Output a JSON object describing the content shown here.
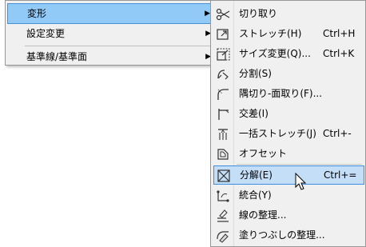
{
  "parent_menu": {
    "items": [
      {
        "label": "変形",
        "has_submenu": true,
        "active": true
      },
      {
        "label": "設定変更",
        "has_submenu": true,
        "active": false
      },
      {
        "label": "基準線/基準面",
        "has_submenu": true,
        "active": false
      }
    ],
    "submenu_arrow": "▶"
  },
  "submenu": {
    "items": [
      {
        "label": "切り取り",
        "shortcut": "",
        "icon": "scissors-icon"
      },
      {
        "label": "ストレッチ(H)",
        "shortcut": "Ctrl+H",
        "icon": "stretch-icon"
      },
      {
        "label": "サイズ変更(Q)...",
        "shortcut": "Ctrl+K",
        "icon": "resize-icon"
      },
      {
        "label": "分割(S)",
        "shortcut": "",
        "icon": "split-icon"
      },
      {
        "label": "隅切り-面取り(F)...",
        "shortcut": "",
        "icon": "fillet-icon"
      },
      {
        "label": "交差(I)",
        "shortcut": "",
        "icon": "intersect-icon"
      },
      {
        "label": "一括ストレッチ(J)",
        "shortcut": "Ctrl+-",
        "icon": "bulk-stretch-icon"
      },
      {
        "label": "オフセット",
        "shortcut": "",
        "icon": "offset-icon"
      },
      {
        "label": "分解(E)",
        "shortcut": "Ctrl+=",
        "icon": "explode-icon",
        "active": true
      },
      {
        "label": "統合(Y)",
        "shortcut": "",
        "icon": "merge-icon"
      },
      {
        "label": "線の整理...",
        "shortcut": "",
        "icon": "line-cleanup-icon"
      },
      {
        "label": "塗りつぶしの整理...",
        "shortcut": "",
        "icon": "fill-cleanup-icon"
      }
    ]
  },
  "colors": {
    "menu_bg": "#f0f0f0",
    "highlight_parent": "#91c9f7",
    "highlight_sub": "#c4def7",
    "highlight_border": "#3d8ee0"
  }
}
